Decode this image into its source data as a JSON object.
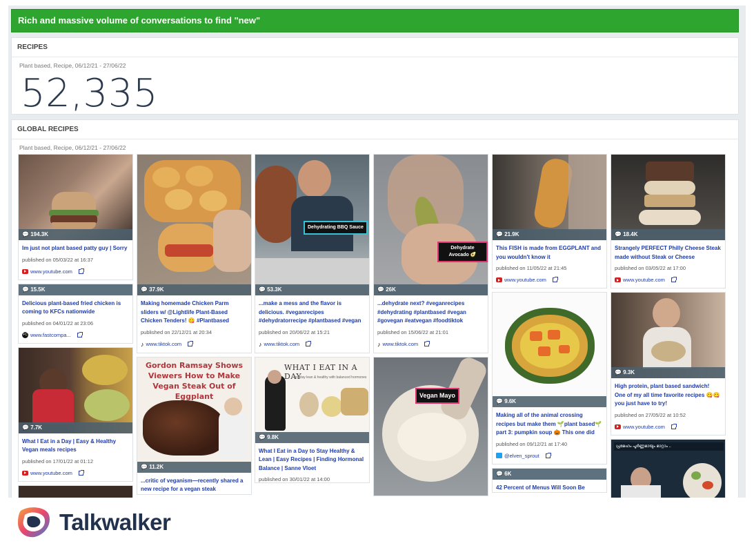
{
  "banner": {
    "title": "Rich and massive volume of conversations to find \"new\""
  },
  "recipes_panel": {
    "title": "RECIPES",
    "subtitle": "Plant based, Recipe, 06/12/21 - 27/06/22",
    "count": "52,335"
  },
  "global_panel": {
    "title": "GLOBAL RECIPES",
    "subtitle": "Plant based, Recipe, 06/12/21 - 27/06/22"
  },
  "posts": [
    {
      "stat": "194.3K",
      "caption": "Im just not plant based patty guy | Sorry",
      "published": "published on 05/03/22 at 16:37",
      "source": "www.youtube.com",
      "source_icon": "youtube-icon"
    },
    {
      "stat": "15.5K",
      "caption": "Delicious plant-based fried chicken is coming to KFCs nationwide",
      "published": "published on 04/01/22 at 23:06",
      "source": "www.fastcompa...",
      "source_icon": "fastcompany-icon"
    },
    {
      "stat": "7.7K",
      "caption": "What I Eat in a Day | Easy & Healthy Vegan meals recipes",
      "published": "published on 17/01/22 at 01:12",
      "source": "www.youtube.com",
      "source_icon": "youtube-icon"
    },
    {
      "stat": "37.9K",
      "caption": "Making homemade Chicken Parm sliders w/ @Lightlife Plant-Based Chicken Tenders! 😋 #Plantbased",
      "published": "published on 22/12/21 at 20:34",
      "source": "www.tiktok.com",
      "source_icon": "tiktok-icon"
    },
    {
      "stat": "11.2K",
      "caption": "...critic of veganism—recently shared a new recipe for a vegan steak",
      "thumb_title": "Gordon Ramsay Shows Viewers How to Make Vegan Steak Out of Eggplant"
    },
    {
      "stat": "53.3K",
      "caption": "...make a mess and the flavor is delicious. #veganrecipes #dehydratorrecipe #plantbased #vegan",
      "published": "published on 20/06/22 at 15:21",
      "source": "www.tiktok.com",
      "source_icon": "tiktok-icon",
      "overlay": "Dehydrating BBQ Sauce"
    },
    {
      "stat": "9.8K",
      "caption": "What I Eat in a Day to Stay Healthy & Lean | Easy Recipes | Finding Hormonal Balance | Sanne Vloet",
      "published": "published on 30/01/22 at 14:00",
      "thumb_title": "WHAT I EAT IN A DAY",
      "thumb_sub": "to stay lean & healthy with balanced hormones"
    },
    {
      "stat": "26K",
      "caption": "...dehydrate next? #veganrecipes #dehydrating #plantbased #vegan #govegan #eatvegan #foodtiktok",
      "published": "published on 15/06/22 at 21:01",
      "source": "www.tiktok.com",
      "source_icon": "tiktok-icon",
      "overlay": "Dehydrate Avocado 🥑"
    },
    {
      "overlay": "Vegan Mayo"
    },
    {
      "stat": "21.9K",
      "caption": "This FISH is made from EGGPLANT and you wouldn't know it",
      "published": "published on 11/05/22 at 21:45",
      "source": "www.youtube.com",
      "source_icon": "youtube-icon"
    },
    {
      "stat": "9.6K",
      "caption": "Making all of the animal crossing recipes but make them 🌱plant based🌱 part 3: pumpkin soup 🎃 This one did",
      "published": "published on 09/12/21 at 17:40",
      "source": "@elven_sprout",
      "source_icon": "twitter-icon"
    },
    {
      "stat": "6K",
      "caption": "42 Percent of Menus Will Soon Be"
    },
    {
      "stat": "18.4K",
      "caption": "Strangely PERFECT Philly Cheese Steak made without Steak or Cheese",
      "published": "published on 03/05/22 at 17:00",
      "source": "www.youtube.com",
      "source_icon": "youtube-icon"
    },
    {
      "stat": "9.3K",
      "caption": "High protein, plant based sandwich! One of my all time favorite recipes 😋😋 you just have to try!",
      "published": "published on 27/05/22 at 10:52",
      "source": "www.youtube.com",
      "source_icon": "youtube-icon"
    },
    {
      "thumb_title": "പ്രമേഹം പൂർണ്ണമായും മാറ്റാം .."
    }
  ],
  "footer": {
    "brand": "Talkwalker"
  },
  "colors": {
    "banner_green": "#2ea52e",
    "link_blue": "#1e3ba8",
    "stat_bar": "#5d727e",
    "brand_navy": "#22314d"
  }
}
